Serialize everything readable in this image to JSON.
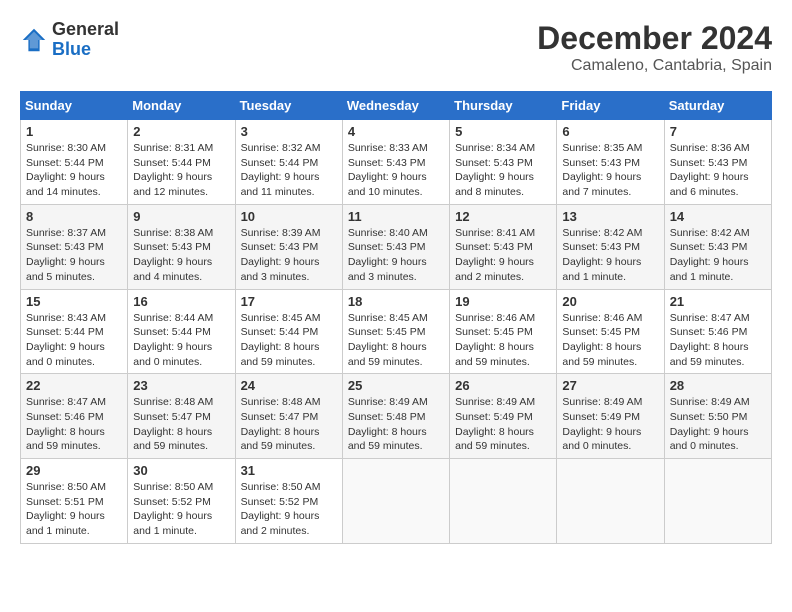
{
  "logo": {
    "general": "General",
    "blue": "Blue"
  },
  "title": "December 2024",
  "location": "Camaleno, Cantabria, Spain",
  "days_of_week": [
    "Sunday",
    "Monday",
    "Tuesday",
    "Wednesday",
    "Thursday",
    "Friday",
    "Saturday"
  ],
  "weeks": [
    [
      {
        "day": "1",
        "sunrise": "8:30 AM",
        "sunset": "5:44 PM",
        "daylight": "9 hours and 14 minutes."
      },
      {
        "day": "2",
        "sunrise": "8:31 AM",
        "sunset": "5:44 PM",
        "daylight": "9 hours and 12 minutes."
      },
      {
        "day": "3",
        "sunrise": "8:32 AM",
        "sunset": "5:44 PM",
        "daylight": "9 hours and 11 minutes."
      },
      {
        "day": "4",
        "sunrise": "8:33 AM",
        "sunset": "5:43 PM",
        "daylight": "9 hours and 10 minutes."
      },
      {
        "day": "5",
        "sunrise": "8:34 AM",
        "sunset": "5:43 PM",
        "daylight": "9 hours and 8 minutes."
      },
      {
        "day": "6",
        "sunrise": "8:35 AM",
        "sunset": "5:43 PM",
        "daylight": "9 hours and 7 minutes."
      },
      {
        "day": "7",
        "sunrise": "8:36 AM",
        "sunset": "5:43 PM",
        "daylight": "9 hours and 6 minutes."
      }
    ],
    [
      {
        "day": "8",
        "sunrise": "8:37 AM",
        "sunset": "5:43 PM",
        "daylight": "9 hours and 5 minutes."
      },
      {
        "day": "9",
        "sunrise": "8:38 AM",
        "sunset": "5:43 PM",
        "daylight": "9 hours and 4 minutes."
      },
      {
        "day": "10",
        "sunrise": "8:39 AM",
        "sunset": "5:43 PM",
        "daylight": "9 hours and 3 minutes."
      },
      {
        "day": "11",
        "sunrise": "8:40 AM",
        "sunset": "5:43 PM",
        "daylight": "9 hours and 3 minutes."
      },
      {
        "day": "12",
        "sunrise": "8:41 AM",
        "sunset": "5:43 PM",
        "daylight": "9 hours and 2 minutes."
      },
      {
        "day": "13",
        "sunrise": "8:42 AM",
        "sunset": "5:43 PM",
        "daylight": "9 hours and 1 minute."
      },
      {
        "day": "14",
        "sunrise": "8:42 AM",
        "sunset": "5:43 PM",
        "daylight": "9 hours and 1 minute."
      }
    ],
    [
      {
        "day": "15",
        "sunrise": "8:43 AM",
        "sunset": "5:44 PM",
        "daylight": "9 hours and 0 minutes."
      },
      {
        "day": "16",
        "sunrise": "8:44 AM",
        "sunset": "5:44 PM",
        "daylight": "9 hours and 0 minutes."
      },
      {
        "day": "17",
        "sunrise": "8:45 AM",
        "sunset": "5:44 PM",
        "daylight": "8 hours and 59 minutes."
      },
      {
        "day": "18",
        "sunrise": "8:45 AM",
        "sunset": "5:45 PM",
        "daylight": "8 hours and 59 minutes."
      },
      {
        "day": "19",
        "sunrise": "8:46 AM",
        "sunset": "5:45 PM",
        "daylight": "8 hours and 59 minutes."
      },
      {
        "day": "20",
        "sunrise": "8:46 AM",
        "sunset": "5:45 PM",
        "daylight": "8 hours and 59 minutes."
      },
      {
        "day": "21",
        "sunrise": "8:47 AM",
        "sunset": "5:46 PM",
        "daylight": "8 hours and 59 minutes."
      }
    ],
    [
      {
        "day": "22",
        "sunrise": "8:47 AM",
        "sunset": "5:46 PM",
        "daylight": "8 hours and 59 minutes."
      },
      {
        "day": "23",
        "sunrise": "8:48 AM",
        "sunset": "5:47 PM",
        "daylight": "8 hours and 59 minutes."
      },
      {
        "day": "24",
        "sunrise": "8:48 AM",
        "sunset": "5:47 PM",
        "daylight": "8 hours and 59 minutes."
      },
      {
        "day": "25",
        "sunrise": "8:49 AM",
        "sunset": "5:48 PM",
        "daylight": "8 hours and 59 minutes."
      },
      {
        "day": "26",
        "sunrise": "8:49 AM",
        "sunset": "5:49 PM",
        "daylight": "8 hours and 59 minutes."
      },
      {
        "day": "27",
        "sunrise": "8:49 AM",
        "sunset": "5:49 PM",
        "daylight": "9 hours and 0 minutes."
      },
      {
        "day": "28",
        "sunrise": "8:49 AM",
        "sunset": "5:50 PM",
        "daylight": "9 hours and 0 minutes."
      }
    ],
    [
      {
        "day": "29",
        "sunrise": "8:50 AM",
        "sunset": "5:51 PM",
        "daylight": "9 hours and 1 minute."
      },
      {
        "day": "30",
        "sunrise": "8:50 AM",
        "sunset": "5:52 PM",
        "daylight": "9 hours and 1 minute."
      },
      {
        "day": "31",
        "sunrise": "8:50 AM",
        "sunset": "5:52 PM",
        "daylight": "9 hours and 2 minutes."
      },
      null,
      null,
      null,
      null
    ]
  ],
  "sunrise_label": "Sunrise:",
  "sunset_label": "Sunset:",
  "daylight_label": "Daylight:"
}
